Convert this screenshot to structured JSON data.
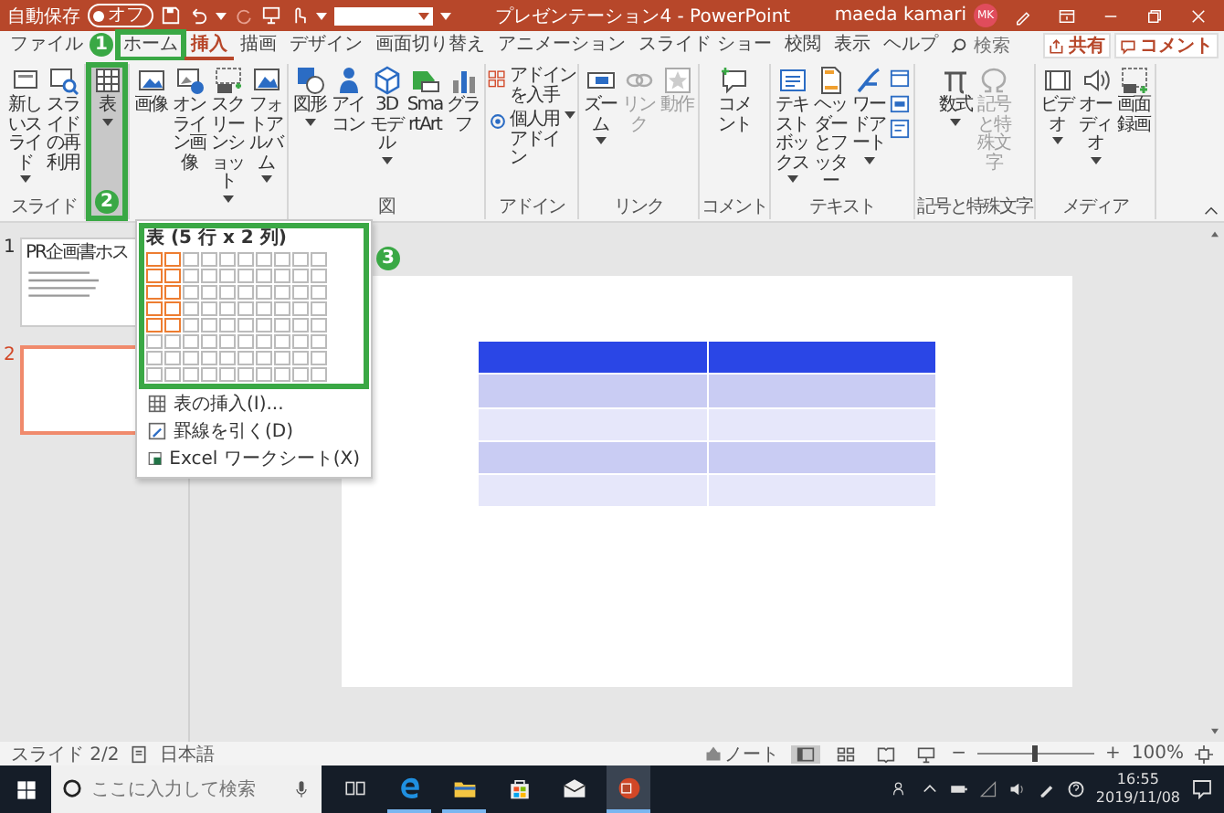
{
  "window": {
    "autosave_label": "自動保存",
    "autosave": {
      "text": "オフ",
      "on": false
    },
    "title": "プレゼンテーション4 - PowerPoint",
    "user": "maeda kamari",
    "avatar": "MK"
  },
  "tabs": [
    {
      "label": "ファイル",
      "selected": false
    },
    {
      "label": "ホーム",
      "selected": false,
      "callout": "1"
    },
    {
      "label": "挿入",
      "selected": true
    },
    {
      "label": "描画",
      "selected": false
    },
    {
      "label": "デザイン",
      "selected": false
    },
    {
      "label": "画面切り替え",
      "selected": false
    },
    {
      "label": "アニメーション",
      "selected": false
    },
    {
      "label": "スライド ショー",
      "selected": false
    },
    {
      "label": "校閲",
      "selected": false
    },
    {
      "label": "表示",
      "selected": false
    },
    {
      "label": "ヘルプ",
      "selected": false
    }
  ],
  "search": {
    "placeholder": "検索"
  },
  "share_button": "共有",
  "comment_button": "コメント",
  "ribbon": {
    "groups": [
      {
        "kind": "large",
        "label": "スライド",
        "buttons": [
          {
            "label": "新しいスライド",
            "dropdown": true,
            "disabled": false,
            "pressed": false
          },
          {
            "label": "スライドの再利用",
            "dropdown": false,
            "disabled": false,
            "pressed": false
          }
        ]
      },
      {
        "kind": "large",
        "buttons": [
          {
            "label": "表",
            "dropdown": true,
            "disabled": false,
            "pressed": true,
            "callout": "2",
            "menu": {
              "title": "表 (5 行 x 2 列)",
              "callout": "3",
              "grid": [
                [
                  true,
                  true,
                  false,
                  false,
                  false,
                  false,
                  false,
                  false,
                  false,
                  false
                ],
                [
                  true,
                  true,
                  false,
                  false,
                  false,
                  false,
                  false,
                  false,
                  false,
                  false
                ],
                [
                  true,
                  true,
                  false,
                  false,
                  false,
                  false,
                  false,
                  false,
                  false,
                  false
                ],
                [
                  true,
                  true,
                  false,
                  false,
                  false,
                  false,
                  false,
                  false,
                  false,
                  false
                ],
                [
                  true,
                  true,
                  false,
                  false,
                  false,
                  false,
                  false,
                  false,
                  false,
                  false
                ],
                [
                  false,
                  false,
                  false,
                  false,
                  false,
                  false,
                  false,
                  false,
                  false,
                  false
                ],
                [
                  false,
                  false,
                  false,
                  false,
                  false,
                  false,
                  false,
                  false,
                  false,
                  false
                ],
                [
                  false,
                  false,
                  false,
                  false,
                  false,
                  false,
                  false,
                  false,
                  false,
                  false
                ]
              ],
              "items": [
                "表の挿入(I)...",
                "罫線を引く(D)",
                "Excel ワークシート(X)"
              ]
            }
          }
        ]
      },
      {
        "kind": "large",
        "buttons": [
          {
            "label": "画像",
            "dropdown": false,
            "disabled": false,
            "pressed": false
          },
          {
            "label": "オンライン画像",
            "dropdown": false,
            "disabled": false,
            "pressed": false
          },
          {
            "label": "スクリーンショット",
            "dropdown": true,
            "disabled": false,
            "pressed": false
          },
          {
            "label": "フォトアルバム",
            "dropdown": true,
            "disabled": false,
            "pressed": false
          }
        ]
      },
      {
        "kind": "large",
        "label": "図",
        "buttons": [
          {
            "label": "図形",
            "dropdown": true,
            "disabled": false,
            "pressed": false
          },
          {
            "label": "アイコン",
            "dropdown": false,
            "disabled": false,
            "pressed": false
          },
          {
            "label": "3Dモデル",
            "dropdown": true,
            "disabled": false,
            "pressed": false
          },
          {
            "label": "SmartArt",
            "dropdown": false,
            "disabled": false,
            "pressed": false
          },
          {
            "label": "グラフ",
            "dropdown": false,
            "disabled": false,
            "pressed": false
          }
        ]
      },
      {
        "kind": "small",
        "label": "アドイン",
        "buttons": [
          {
            "label": "アドインを入手",
            "dropdown": false,
            "disabled": false,
            "pressed": false
          },
          {
            "label": "個人用アドイン",
            "dropdown": true,
            "disabled": false,
            "pressed": false
          }
        ]
      },
      {
        "kind": "large",
        "label": "リンク",
        "buttons": [
          {
            "label": "ズーム",
            "dropdown": true,
            "disabled": false,
            "pressed": false
          },
          {
            "label": "リンク",
            "dropdown": false,
            "disabled": true,
            "pressed": false
          },
          {
            "label": "動作",
            "dropdown": false,
            "disabled": true,
            "pressed": false
          }
        ]
      },
      {
        "kind": "large",
        "label": "コメント",
        "buttons": [
          {
            "label": "コメント",
            "dropdown": false,
            "disabled": false,
            "pressed": false
          }
        ]
      },
      {
        "kind": "mixed",
        "label": "テキスト",
        "buttons": [
          {
            "label": "テキストボックス",
            "dropdown": true,
            "disabled": false,
            "pressed": false
          },
          {
            "label": "ヘッダーとフッター",
            "dropdown": false,
            "disabled": false,
            "pressed": false
          },
          {
            "label": "ワードアート",
            "dropdown": true,
            "disabled": false,
            "pressed": false
          }
        ]
      },
      {
        "kind": "large",
        "label": "記号と特殊文字",
        "buttons": [
          {
            "label": "数式",
            "dropdown": true,
            "disabled": false,
            "pressed": false
          },
          {
            "label": "記号と特殊文字",
            "dropdown": false,
            "disabled": true,
            "pressed": false
          }
        ]
      },
      {
        "kind": "large",
        "label": "メディア",
        "buttons": [
          {
            "label": "ビデオ",
            "dropdown": true,
            "disabled": false,
            "pressed": false
          },
          {
            "label": "オーディオ",
            "dropdown": true,
            "disabled": false,
            "pressed": false
          },
          {
            "label": "画面録画",
            "dropdown": false,
            "disabled": false,
            "pressed": false
          }
        ]
      }
    ]
  },
  "slides": [
    {
      "number": "1",
      "selected": false,
      "title": "PR企画書ホス"
    },
    {
      "number": "2",
      "selected": true
    }
  ],
  "slide_table": {
    "rows": [
      {
        "kind": "header"
      },
      {
        "kind": "band"
      },
      {
        "kind": "plain"
      },
      {
        "kind": "band"
      },
      {
        "kind": "plain"
      }
    ]
  },
  "status_bar": {
    "slide_info": "スライド 2/2",
    "language": "日本語",
    "notes_button": "ノート",
    "views": [
      {
        "selected": true
      },
      {
        "selected": false
      },
      {
        "selected": false
      },
      {
        "selected": false
      }
    ],
    "zoom_out": "−",
    "zoom": {
      "level": 0.5
    },
    "zoom_in": "+",
    "zoom_reading": "100%"
  },
  "taskbar": {
    "search": {
      "placeholder": "ここに入力して検索"
    },
    "apps": [
      {
        "running": false,
        "active": false
      },
      {
        "running": true,
        "active": false
      },
      {
        "running": true,
        "active": false
      },
      {
        "running": false,
        "active": false
      },
      {
        "running": false,
        "active": false
      },
      {
        "running": true,
        "active": true
      }
    ],
    "time": "16:55",
    "date": "2019/11/08"
  }
}
